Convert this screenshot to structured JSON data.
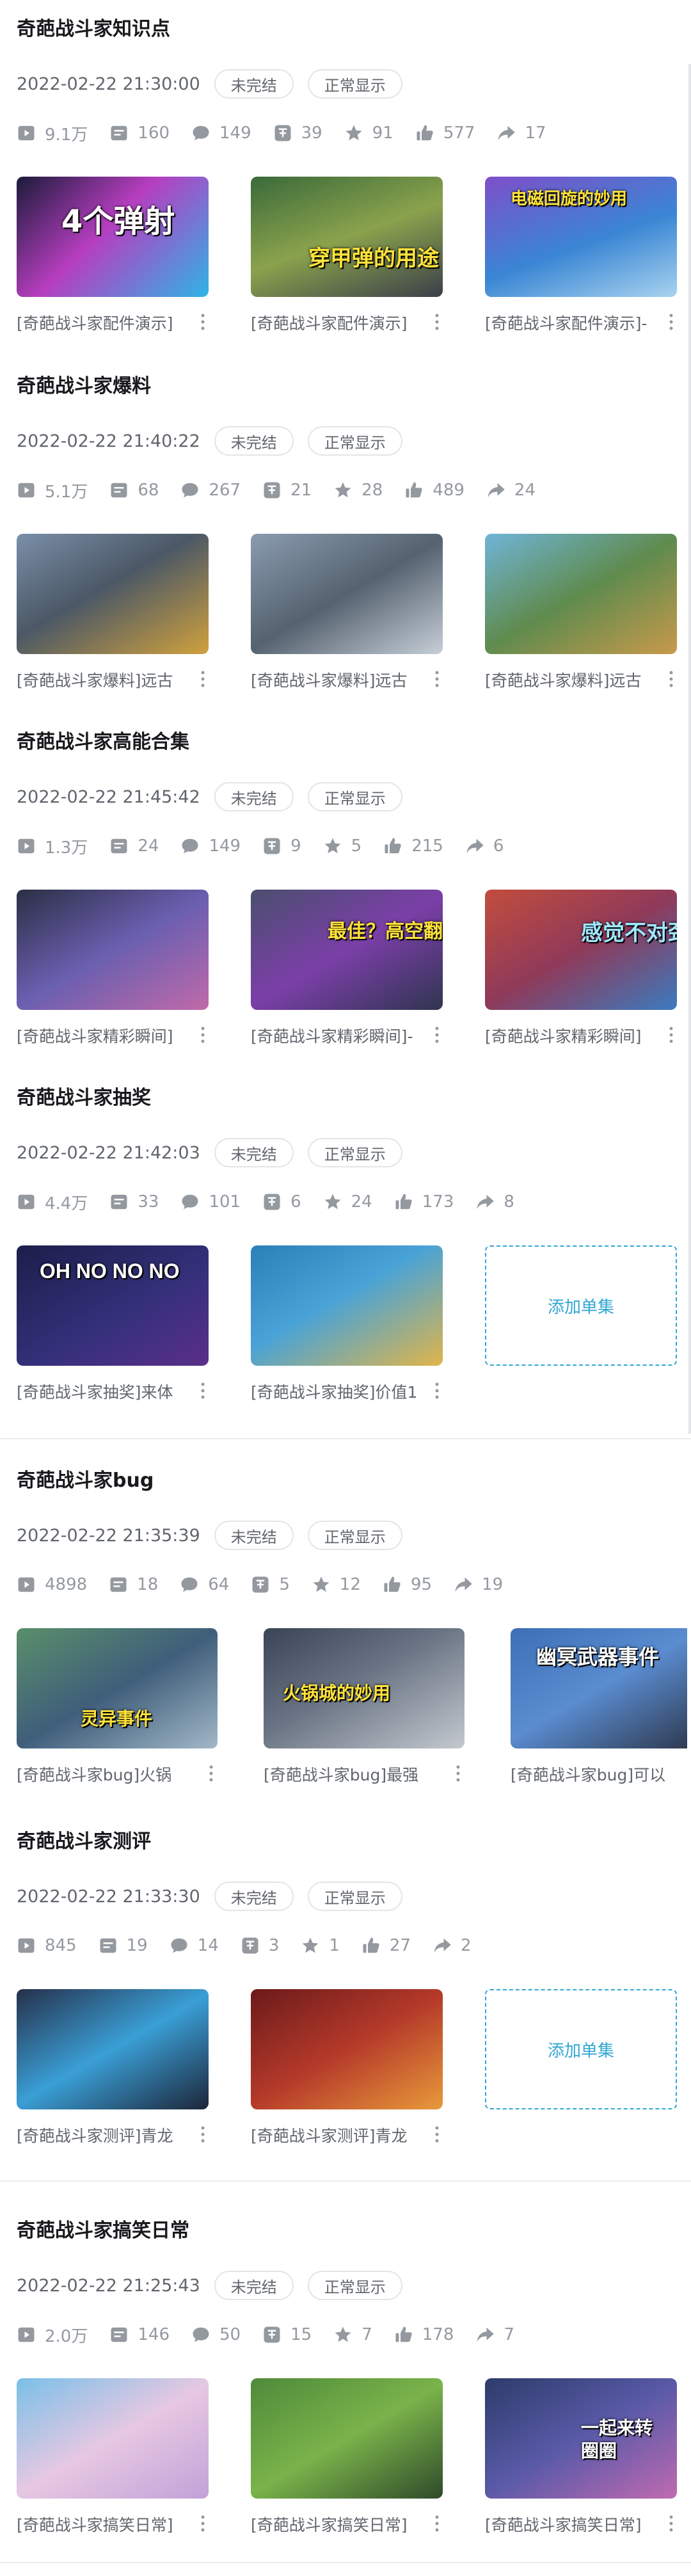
{
  "collections": [
    {
      "title": "奇葩战斗家知识点",
      "date": "2022-02-22 21:30:00",
      "status_tags": [
        "未完结",
        "正常显示"
      ],
      "stats": {
        "play": "9.1万",
        "danmaku": "160",
        "comment": "149",
        "coin": "39",
        "favorite": "91",
        "like": "577",
        "share": "17"
      },
      "videos": [
        {
          "caption": "[奇葩战斗家配件演示]",
          "overlay": "4个弹射"
        },
        {
          "caption": "[奇葩战斗家配件演示]",
          "overlay": "穿甲弹的用途"
        },
        {
          "caption": "[奇葩战斗家配件演示]-",
          "overlay": "电磁回旋的妙用"
        }
      ]
    },
    {
      "title": "奇葩战斗家爆料",
      "date": "2022-02-22 21:40:22",
      "status_tags": [
        "未完结",
        "正常显示"
      ],
      "stats": {
        "play": "5.1万",
        "danmaku": "68",
        "comment": "267",
        "coin": "21",
        "favorite": "28",
        "like": "489",
        "share": "24"
      },
      "videos": [
        {
          "caption": "[奇葩战斗家爆料]远古",
          "overlay": ""
        },
        {
          "caption": "[奇葩战斗家爆料]远古",
          "overlay": ""
        },
        {
          "caption": "[奇葩战斗家爆料]远古",
          "overlay": ""
        }
      ]
    },
    {
      "title": "奇葩战斗家高能合集",
      "date": "2022-02-22 21:45:42",
      "status_tags": [
        "未完结",
        "正常显示"
      ],
      "stats": {
        "play": "1.3万",
        "danmaku": "24",
        "comment": "149",
        "coin": "9",
        "favorite": "5",
        "like": "215",
        "share": "6"
      },
      "videos": [
        {
          "caption": "[奇葩战斗家精彩瞬间]",
          "overlay": ""
        },
        {
          "caption": "[奇葩战斗家精彩瞬间]-",
          "overlay": "最佳？高空翻滚"
        },
        {
          "caption": "[奇葩战斗家精彩瞬间]",
          "overlay": "感觉不对劲"
        }
      ]
    },
    {
      "title": "奇葩战斗家抽奖",
      "date": "2022-02-22 21:42:03",
      "status_tags": [
        "未完结",
        "正常显示"
      ],
      "stats": {
        "play": "4.4万",
        "danmaku": "33",
        "comment": "101",
        "coin": "6",
        "favorite": "24",
        "like": "173",
        "share": "8"
      },
      "videos": [
        {
          "caption": "[奇葩战斗家抽奖]来体",
          "overlay": "OH NO NO NO"
        },
        {
          "caption": "[奇葩战斗家抽奖]价值1",
          "overlay": ""
        }
      ],
      "add_label": "添加单集"
    },
    {
      "title": "奇葩战斗家bug",
      "date": "2022-02-22 21:35:39",
      "status_tags": [
        "未完结",
        "正常显示"
      ],
      "stats": {
        "play": "4898",
        "danmaku": "18",
        "comment": "64",
        "coin": "5",
        "favorite": "12",
        "like": "95",
        "share": "19"
      },
      "videos": [
        {
          "caption": "[奇葩战斗家bug]火锅",
          "overlay": "灵异事件"
        },
        {
          "caption": "[奇葩战斗家bug]最强",
          "overlay": "火锅城的妙用"
        },
        {
          "caption": "[奇葩战斗家bug]可以",
          "overlay": "幽冥武器事件"
        }
      ]
    },
    {
      "title": "奇葩战斗家测评",
      "date": "2022-02-22 21:33:30",
      "status_tags": [
        "未完结",
        "正常显示"
      ],
      "stats": {
        "play": "845",
        "danmaku": "19",
        "comment": "14",
        "coin": "3",
        "favorite": "1",
        "like": "27",
        "share": "2"
      },
      "videos": [
        {
          "caption": "[奇葩战斗家测评]青龙",
          "overlay": ""
        },
        {
          "caption": "[奇葩战斗家测评]青龙",
          "overlay": ""
        }
      ],
      "add_label": "添加单集"
    },
    {
      "title": "奇葩战斗家搞笑日常",
      "date": "2022-02-22 21:25:43",
      "status_tags": [
        "未完结",
        "正常显示"
      ],
      "stats": {
        "play": "2.0万",
        "danmaku": "146",
        "comment": "50",
        "coin": "15",
        "favorite": "7",
        "like": "178",
        "share": "7"
      },
      "videos": [
        {
          "caption": "[奇葩战斗家搞笑日常]",
          "overlay": ""
        },
        {
          "caption": "[奇葩战斗家搞笑日常]",
          "overlay": ""
        },
        {
          "caption": "[奇葩战斗家搞笑日常]",
          "overlay": "一起来转圈圈"
        }
      ]
    }
  ]
}
